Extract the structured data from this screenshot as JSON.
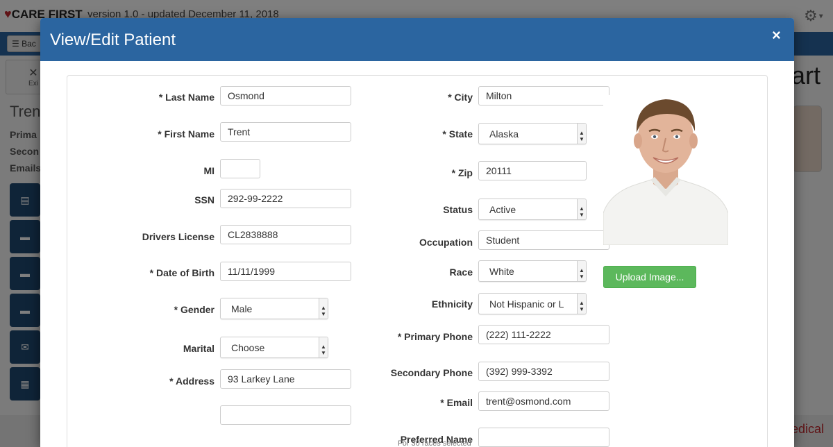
{
  "app": {
    "logo_text": "CARE FIRST",
    "version": "version 1.0 - updated December 11, 2018",
    "back_label": "Bac",
    "exit_label": "Exi",
    "patient_name_partial": "Tren",
    "info_labels": [
      "Prima",
      "Secon",
      "Emails"
    ],
    "chart_partial": "art",
    "footer_partial": "edical",
    "accent_color": "#2b65a0",
    "sidebar_icons": [
      "document-icon",
      "folder-icon",
      "folder-icon",
      "folder-icon",
      "envelope-icon",
      "table-icon"
    ]
  },
  "modal": {
    "title": "View/Edit Patient",
    "close": "×",
    "upload_label": "Upload Image...",
    "hint": "For 30 races selected",
    "fields": {
      "last_name": {
        "label": "* Last Name",
        "value": "Osmond"
      },
      "first_name": {
        "label": "* First Name",
        "value": "Trent"
      },
      "mi": {
        "label": "MI",
        "value": ""
      },
      "ssn": {
        "label": "SSN",
        "value": "292-99-2222"
      },
      "drivers_license": {
        "label": "Drivers License",
        "value": "CL2838888"
      },
      "dob": {
        "label": "* Date of Birth",
        "value": "11/11/1999"
      },
      "gender": {
        "label": "* Gender",
        "value": "Male"
      },
      "marital": {
        "label": "Marital",
        "value": "Choose"
      },
      "address": {
        "label": "* Address",
        "value": "93 Larkey Lane"
      },
      "address2": {
        "value": ""
      },
      "city": {
        "label": "* City",
        "value": "Milton"
      },
      "state": {
        "label": "* State",
        "value": "Alaska"
      },
      "zip": {
        "label": "* Zip",
        "value": "20111"
      },
      "status": {
        "label": "Status",
        "value": "Active"
      },
      "occupation": {
        "label": "Occupation",
        "value": "Student"
      },
      "race": {
        "label": "Race",
        "value": "White"
      },
      "ethnicity": {
        "label": "Ethnicity",
        "value": "Not Hispanic or L"
      },
      "primary_phone": {
        "label": "* Primary Phone",
        "value": "(222) 111-2222"
      },
      "secondary_phone": {
        "label": "Secondary Phone",
        "value": "(392) 999-3392"
      },
      "email": {
        "label": "* Email",
        "value": "trent@osmond.com"
      },
      "preferred_name": {
        "label": "Preferred Name",
        "value": ""
      }
    }
  }
}
